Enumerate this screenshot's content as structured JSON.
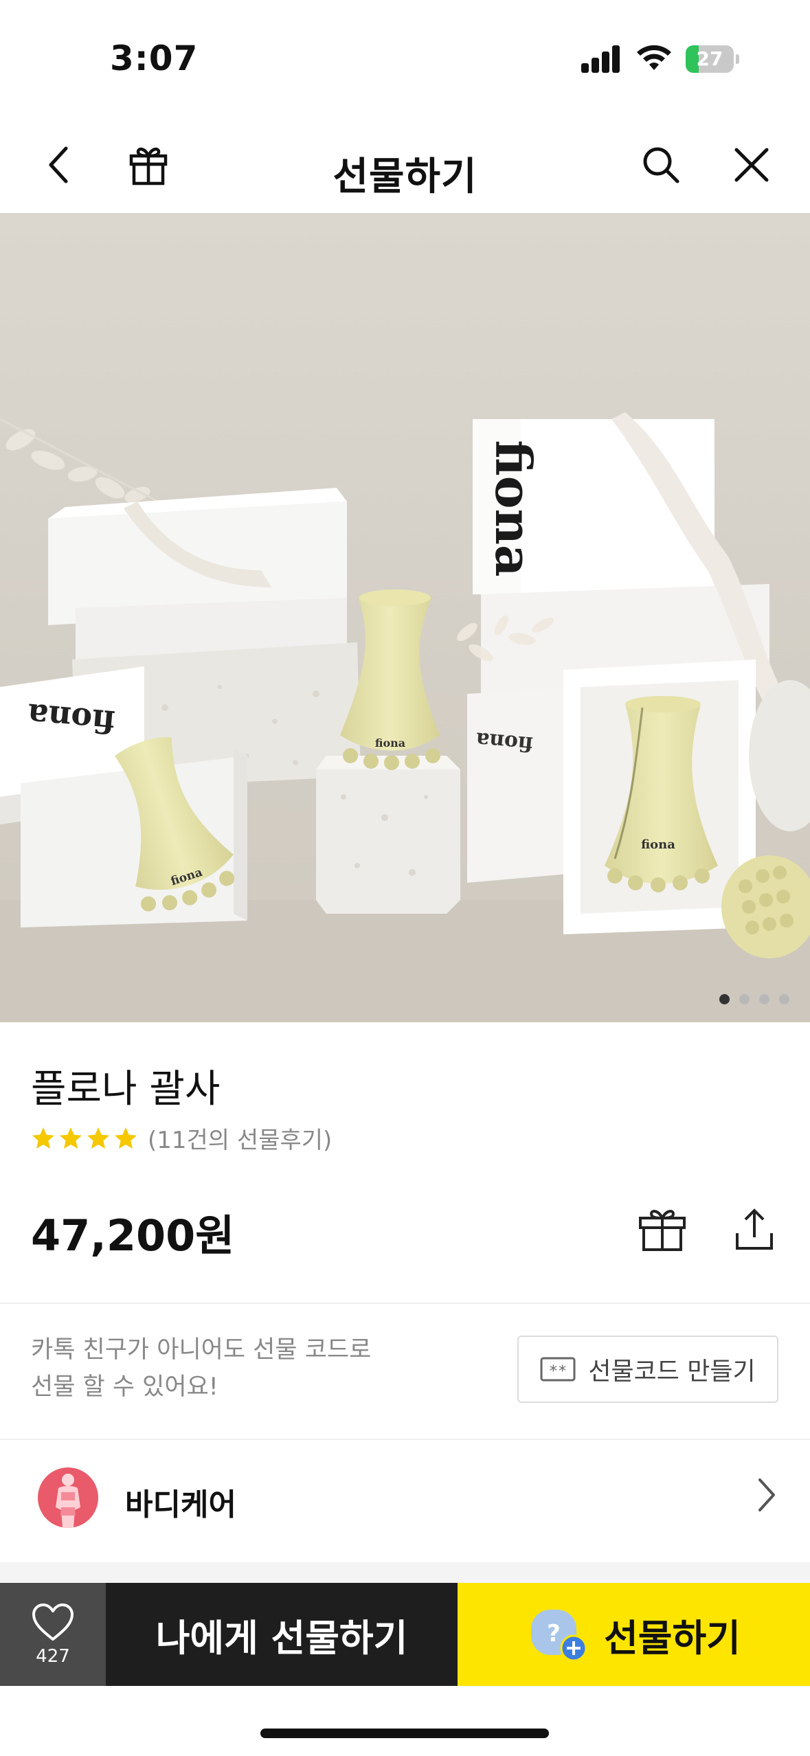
{
  "status_bar": {
    "time": "3:07",
    "battery_percent": "27",
    "battery_level": 0.27,
    "battery_color": "#2fc35b"
  },
  "nav": {
    "title": "선물하기",
    "back_icon": "chevron-left-icon",
    "gift_icon": "gift-icon",
    "search_icon": "search-icon",
    "close_icon": "close-icon"
  },
  "hero": {
    "brand_on_box": "fiona",
    "brand_on_tool": "fiona",
    "page_count": 4,
    "current_page": 1
  },
  "product": {
    "name": "플로나 괄사",
    "rating_stars": 4,
    "review_count_text": "(11건의 선물후기)",
    "price": "47,200원",
    "star_color": "#f5c800"
  },
  "gift_code": {
    "description_line1": "카톡 친구가 아니어도 선물 코드로",
    "description_line2": "선물 할 수 있어요!",
    "button_label": "선물코드 만들기",
    "button_icon_text": "**"
  },
  "category": {
    "label": "바디케어",
    "avatar_color": "#e95a6a"
  },
  "bottom_bar": {
    "like_count": "427",
    "self_gift_label": "나에게 선물하기",
    "gift_label": "선물하기",
    "gift_icon_text": "?",
    "accent_color": "#fee500"
  }
}
